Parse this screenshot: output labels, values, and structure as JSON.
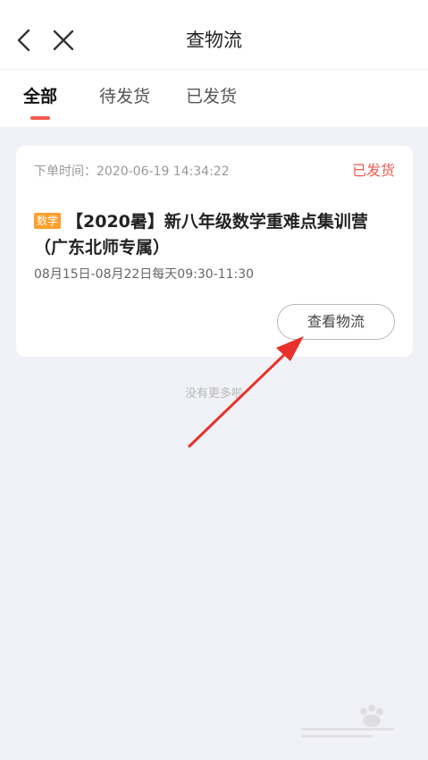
{
  "header": {
    "title": "查物流",
    "back_icon": "chevron-left-icon",
    "close_icon": "close-icon"
  },
  "tabs": [
    {
      "label": "全部",
      "active": true
    },
    {
      "label": "待发货",
      "active": false
    },
    {
      "label": "已发货",
      "active": false
    }
  ],
  "order": {
    "time_label": "下单时间：",
    "time_value": "2020-06-19 14:34:22",
    "status": "已发货",
    "subject_tag": "数学",
    "course_title": "【2020暑】新八年级数学重难点集训营（广东北师专属）",
    "schedule": "08月15日-08月22日每天09:30-11:30",
    "logistics_button": "查看物流"
  },
  "list_end_text": "没有更多啦",
  "colors": {
    "accent": "#f25a4f",
    "tag": "#ff9f2e",
    "background": "#f1f2f7",
    "annotation_arrow": "#e8312a"
  }
}
